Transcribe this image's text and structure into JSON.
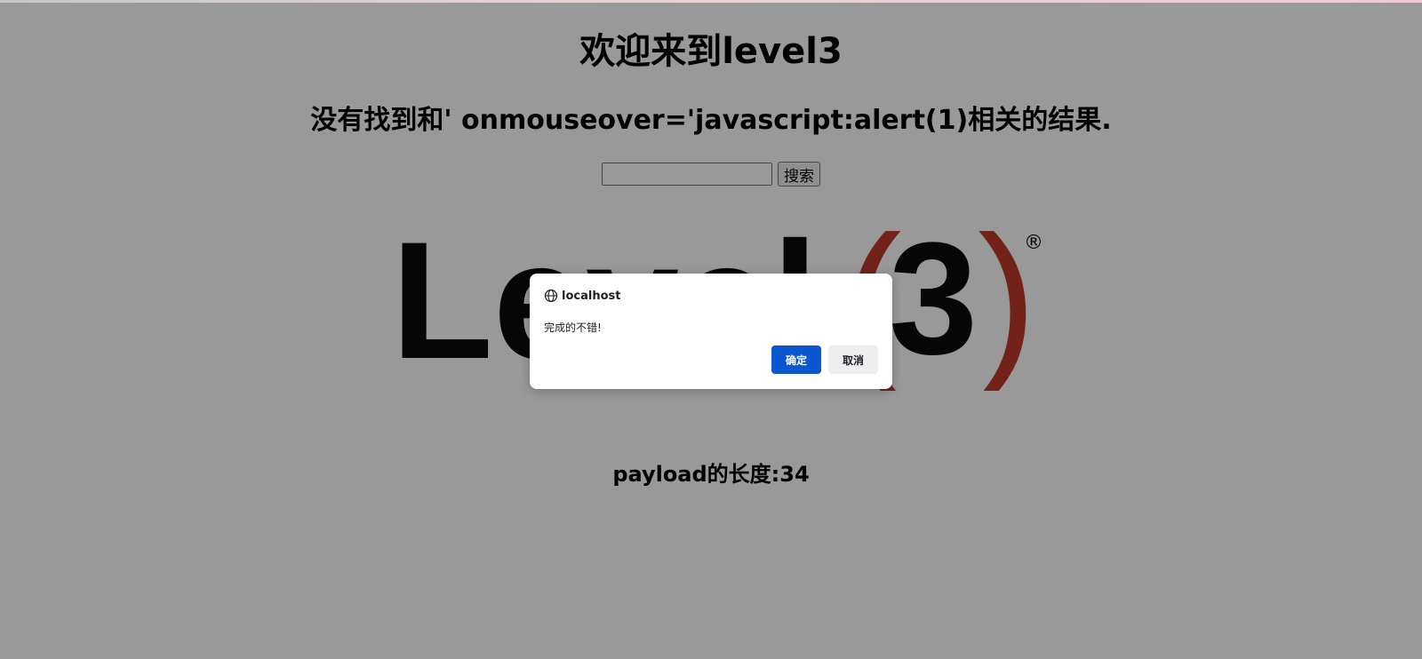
{
  "page": {
    "title": "欢迎来到level3",
    "result_text": "没有找到和' onmouseover='javascript:alert(1)相关的结果.",
    "search": {
      "value": "",
      "button_label": "搜索"
    },
    "logo": {
      "text_main": "Level",
      "text_num": "3",
      "registered_mark": "®",
      "colors": {
        "text": "#0a0a0a",
        "parens": "#c0392b"
      }
    },
    "payload_length_text": "payload的长度:34"
  },
  "dialog": {
    "origin": "localhost",
    "origin_icon": "globe-icon",
    "message": "完成的不错!",
    "ok_label": "确定",
    "cancel_label": "取消",
    "ok_color": "#0b57d0"
  },
  "overlay": {
    "color": "rgba(0,0,0,0.40)"
  }
}
